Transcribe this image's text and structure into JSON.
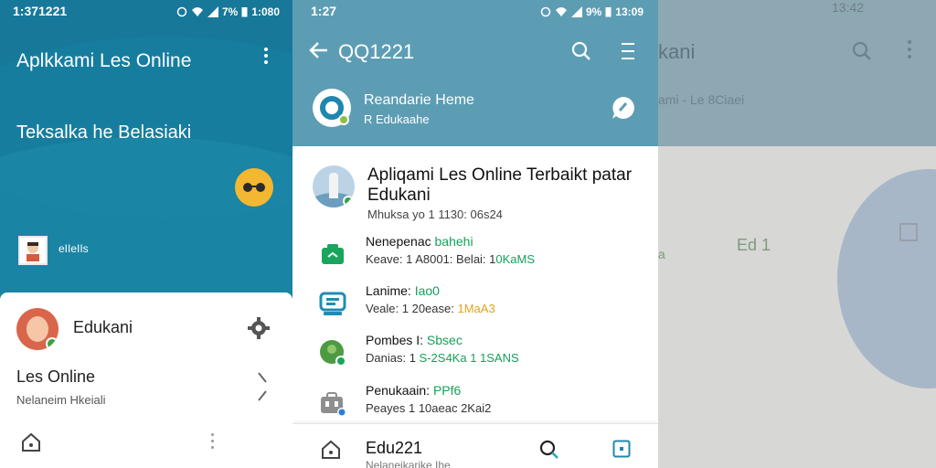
{
  "left": {
    "status_time": "1:371221",
    "status_battery": "7%",
    "status_clock": "1:080",
    "title": "Aplkkami Les Online",
    "subtitle": "Teksalka he Belasiaki",
    "thumb_label": "eIIeIIs",
    "card": {
      "name": "Edukani",
      "section_title": "Les Online",
      "section_sub": "Nelaneim Hkeiali"
    }
  },
  "middle": {
    "status_time": "1:27",
    "status_battery": "9%",
    "status_clock": "13:09",
    "title": "QQ1221",
    "room_name": "Reandarie Heme",
    "room_sub": "R Edukaahe",
    "featured": {
      "title": "Apliqami Les Online Terbaikt patar Edukani",
      "meta": "Mhuksa yo 1 1130: 06s24"
    },
    "items": [
      {
        "t1": "Nenepenac",
        "t1_accent": "bahehi",
        "t2": "Keave: 1 A8001: Belai: 1",
        "t2_accent": "0KaMS",
        "accent_type": "green",
        "icon": "camera-bag-icon"
      },
      {
        "t1": "Lanime:",
        "t1_accent": "Iao0",
        "t2": "Veale: 1 20ease:",
        "t2_accent": "1MaA3",
        "accent_type": "yellow",
        "icon": "pc-monitor-icon"
      },
      {
        "t1": "Pombes I:",
        "t1_accent": "Sbsec",
        "t2": "Danias: 1",
        "t2_accent": "S-2S4Ka 1 1SANS",
        "accent_type": "green",
        "icon": "globe-user-icon"
      },
      {
        "t1": "Penukaain:",
        "t1_accent": "PPf6",
        "t2": "Peayes 1 10aeac 2Kai2",
        "t2_accent": "",
        "accent_type": "green",
        "icon": "briefcase-icon"
      }
    ],
    "bottom": {
      "title": "Edu221",
      "sub": "Nelaneikarike Ihe"
    }
  },
  "right": {
    "status_clock": "13:42",
    "title": "kani",
    "sub": "ami - Le 8Ciaei",
    "edu_label": "Ed 1",
    "accent_char": "a"
  }
}
